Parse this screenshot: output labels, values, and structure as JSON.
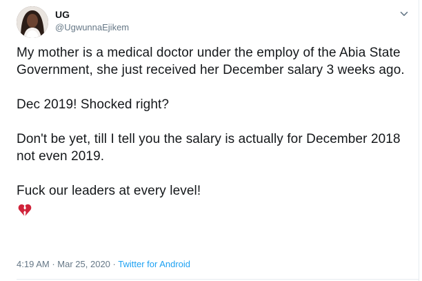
{
  "author": {
    "display_name": "UG",
    "handle": "@UgwunnaEjikem"
  },
  "tweet": {
    "paragraphs": [
      "My mother is a medical doctor under the employ of the Abia State Government, she just received her December salary 3 weeks ago.",
      "Dec 2019! Shocked right?",
      "Don't be yet, till I tell you the salary is actually for December 2018 not even 2019.",
      "Fuck our leaders at every level!"
    ],
    "emoji": "broken-heart-icon"
  },
  "meta": {
    "time": "4:19 AM",
    "separator": "·",
    "date": "Mar 25, 2020",
    "source": "Twitter for Android"
  },
  "colors": {
    "text": "#14171a",
    "secondary": "#657786",
    "link": "#1da1f2",
    "border": "#e6ecf0",
    "emoji": "#d0233a"
  }
}
